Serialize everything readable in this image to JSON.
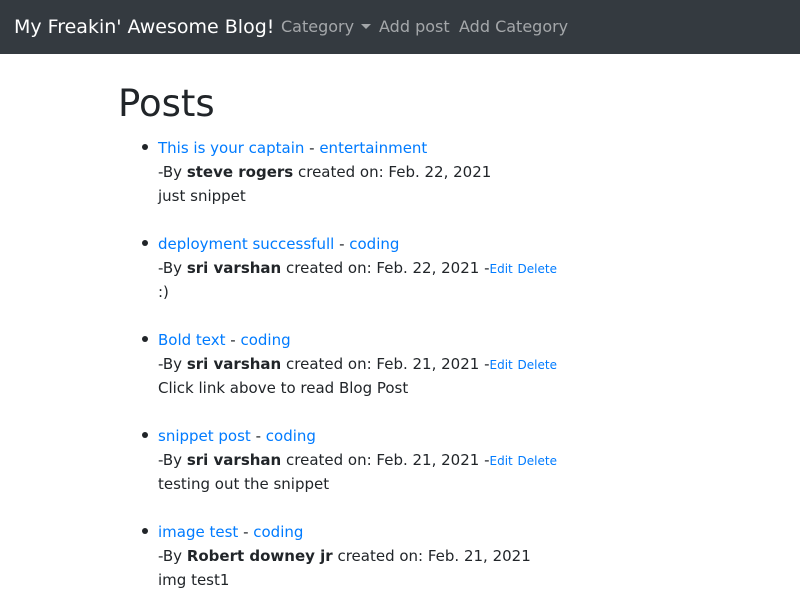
{
  "navbar": {
    "brand": "My Freakin' Awesome Blog!",
    "category_label": "Category",
    "add_post_label": "Add post",
    "add_category_label": "Add Category",
    "caret_icon": "caret-down-icon"
  },
  "page": {
    "title": "Posts"
  },
  "post_labels": {
    "separator": " - ",
    "by_prefix": "-By ",
    "created_on": " created on: ",
    "actions_dash": " -",
    "edit": "Edit",
    "delete": "Delete"
  },
  "posts": [
    {
      "title": "This is your captain",
      "category": "entertainment",
      "author": "steve rogers",
      "date": "Feb. 22, 2021",
      "snippet": "just snippet",
      "editable": false
    },
    {
      "title": "deployment successfull",
      "category": "coding",
      "author": "sri varshan",
      "date": "Feb. 22, 2021",
      "snippet": ":)",
      "editable": true
    },
    {
      "title": "Bold text",
      "category": "coding",
      "author": "sri varshan",
      "date": "Feb. 21, 2021",
      "snippet": "Click link above to read Blog Post",
      "editable": true
    },
    {
      "title": "snippet post",
      "category": "coding",
      "author": "sri varshan",
      "date": "Feb. 21, 2021",
      "snippet": "testing out the snippet",
      "editable": true
    },
    {
      "title": "image test",
      "category": "coding",
      "author": "Robert downey jr",
      "date": "Feb. 21, 2021",
      "snippet": "img test1",
      "editable": false
    }
  ],
  "colors": {
    "navbar_bg": "#343a40",
    "link": "#007bff",
    "text": "#212529"
  }
}
